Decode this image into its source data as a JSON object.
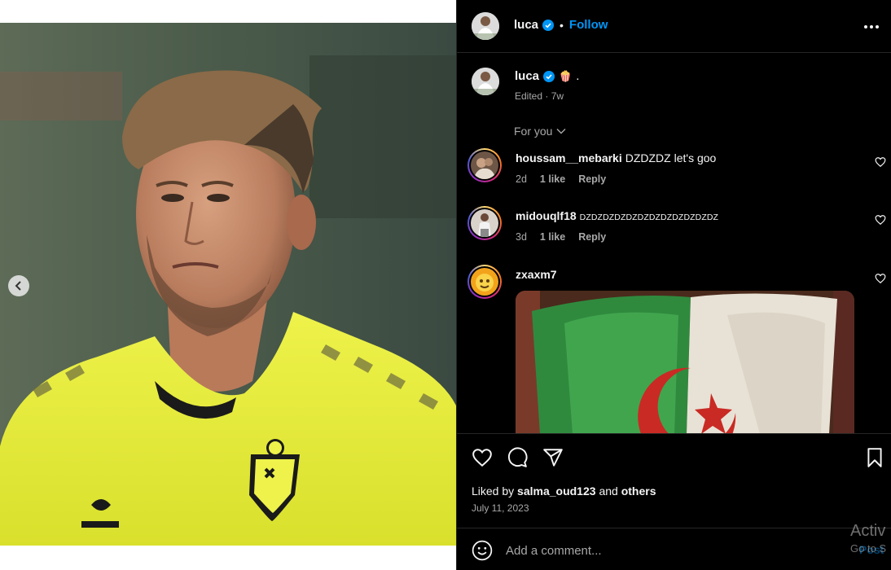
{
  "post": {
    "author": "luca",
    "follow_label": "Follow",
    "dot": "•",
    "caption_text": ".",
    "caption_emoji": "🍿",
    "caption_meta": "Edited · 7w"
  },
  "sort": {
    "label": "For you"
  },
  "comments": [
    {
      "username": "houssam__mebarki",
      "text": "DZDZDZ let's goo",
      "age": "2d",
      "likes": "1 like",
      "reply": "Reply"
    },
    {
      "username": "midouqlf18",
      "text": "DZDZDZDZDZDZDZDZDZDZDZDZ",
      "age": "3d",
      "likes": "1 like",
      "reply": "Reply"
    },
    {
      "username": "zxaxm7",
      "text": ""
    }
  ],
  "actions": {
    "liked_prefix": "Liked by",
    "liked_user": "salma_oud123",
    "liked_and": "and",
    "liked_others": "others",
    "date": "July 11, 2023"
  },
  "composer": {
    "placeholder": "Add a comment...",
    "post_label": "Post"
  },
  "watermark": {
    "line1": "Activ",
    "line2": "Go to S"
  },
  "colors": {
    "accent": "#0095f6",
    "background": "#000000",
    "muted": "#a8a8a8",
    "jersey": "#e9f03a"
  },
  "icons": [
    "chevron-left-icon",
    "verified-icon",
    "more-icon",
    "heart-icon",
    "comment-icon",
    "share-icon",
    "bookmark-icon",
    "emoji-icon",
    "chevron-down-icon"
  ]
}
